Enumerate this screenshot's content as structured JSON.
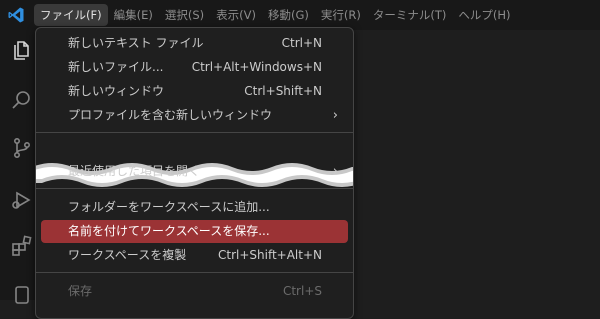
{
  "menubar": {
    "items": [
      {
        "label": "ファイル(F)",
        "active": true
      },
      {
        "label": "編集(E)"
      },
      {
        "label": "選択(S)"
      },
      {
        "label": "表示(V)"
      },
      {
        "label": "移動(G)"
      },
      {
        "label": "実行(R)"
      },
      {
        "label": "ターミナル(T)"
      },
      {
        "label": "ヘルプ(H)"
      }
    ]
  },
  "file_menu": {
    "items": [
      {
        "label": "新しいテキスト ファイル",
        "shortcut": "Ctrl+N"
      },
      {
        "label": "新しいファイル...",
        "shortcut": "Ctrl+Alt+Windows+N"
      },
      {
        "label": "新しいウィンドウ",
        "shortcut": "Ctrl+Shift+N"
      },
      {
        "label": "プロファイルを含む新しいウィンドウ",
        "submenu": true
      },
      {
        "label": "最近使用した項目を開く",
        "submenu": true
      },
      {
        "label": "フォルダーをワークスペースに追加..."
      },
      {
        "label": "名前を付けてワークスペースを保存...",
        "selected": true
      },
      {
        "label": "ワークスペースを複製",
        "shortcut": "Ctrl+Shift+Alt+N"
      },
      {
        "label": "保存",
        "shortcut": "Ctrl+S",
        "disabled": true
      }
    ],
    "submenu_glyph": "›"
  },
  "icons": {
    "app": "vscode-logo-icon",
    "activity": [
      "files-icon",
      "search-icon",
      "source-control-icon",
      "run-debug-icon",
      "extensions-icon",
      "account-icon"
    ]
  },
  "colors": {
    "accent_selected": "#9b3335",
    "menu_bg": "#1f1f1f",
    "titlebar_bg": "#181818",
    "editor_bg": "#1e1e1e",
    "logo_blue": "#2f8fe0"
  }
}
